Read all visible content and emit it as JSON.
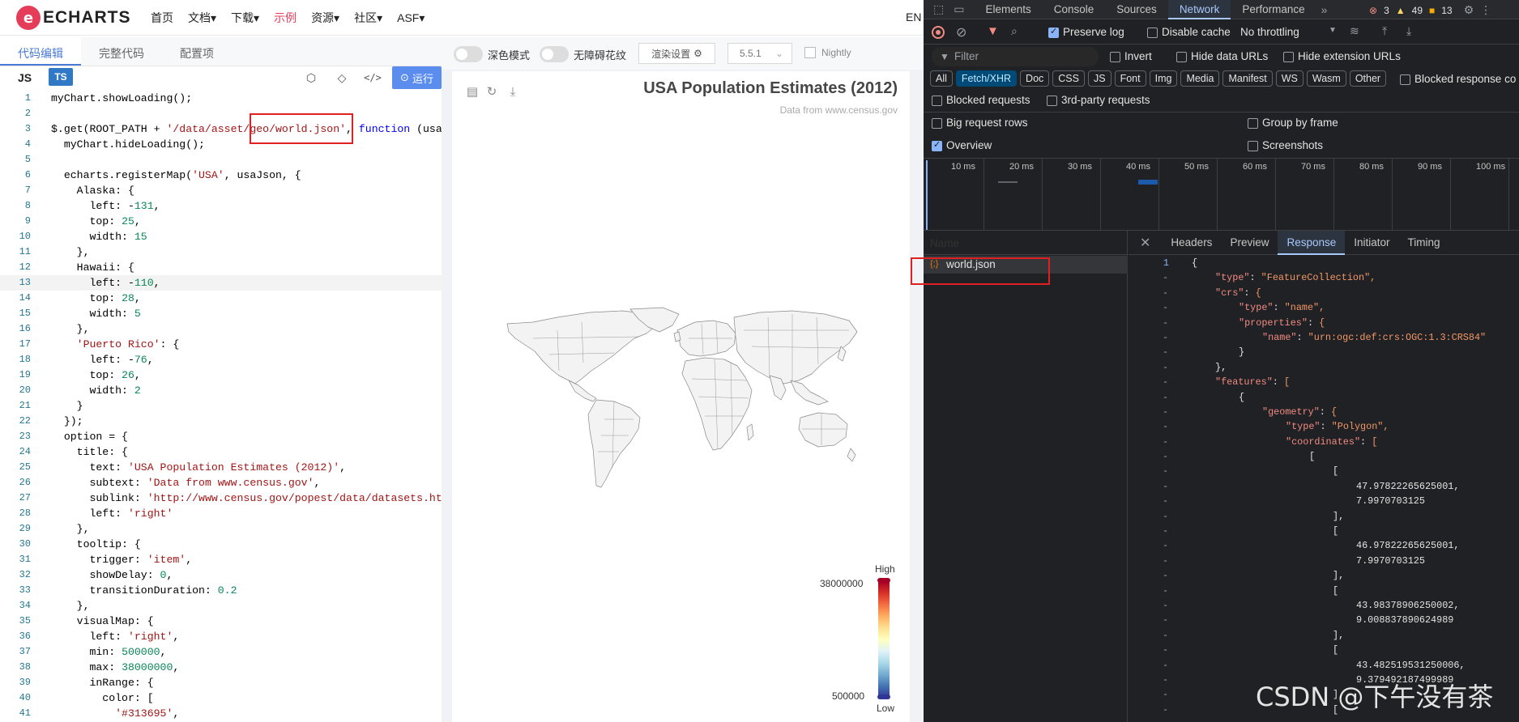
{
  "nav": {
    "logo_text": "ECHARTS",
    "links": [
      "首页",
      "文档▾",
      "下载▾",
      "示例",
      "资源▾",
      "社区▾",
      "ASF▾"
    ],
    "lang": "EN"
  },
  "editor": {
    "tabs": [
      "代码编辑",
      "完整代码",
      "配置项"
    ],
    "lang_js": "JS",
    "lang_ts": "TS",
    "run_label": "运行",
    "lines": [
      {
        "n": 1,
        "text": "myChart.showLoading();"
      },
      {
        "n": 2,
        "text": ""
      },
      {
        "n": 3,
        "text": "$.get(ROOT_PATH + '/data/asset/geo/world.json', function (usaJs"
      },
      {
        "n": 4,
        "text": "  myChart.hideLoading();"
      },
      {
        "n": 5,
        "text": ""
      },
      {
        "n": 6,
        "text": "  echarts.registerMap('USA', usaJson, {"
      },
      {
        "n": 7,
        "text": "    Alaska: {"
      },
      {
        "n": 8,
        "text": "      left: -131,"
      },
      {
        "n": 9,
        "text": "      top: 25,"
      },
      {
        "n": 10,
        "text": "      width: 15"
      },
      {
        "n": 11,
        "text": "    },"
      },
      {
        "n": 12,
        "text": "    Hawaii: {"
      },
      {
        "n": 13,
        "text": "      left: -110,"
      },
      {
        "n": 14,
        "text": "      top: 28,"
      },
      {
        "n": 15,
        "text": "      width: 5"
      },
      {
        "n": 16,
        "text": "    },"
      },
      {
        "n": 17,
        "text": "    'Puerto Rico': {"
      },
      {
        "n": 18,
        "text": "      left: -76,"
      },
      {
        "n": 19,
        "text": "      top: 26,"
      },
      {
        "n": 20,
        "text": "      width: 2"
      },
      {
        "n": 21,
        "text": "    }"
      },
      {
        "n": 22,
        "text": "  });"
      },
      {
        "n": 23,
        "text": "  option = {"
      },
      {
        "n": 24,
        "text": "    title: {"
      },
      {
        "n": 25,
        "text": "      text: 'USA Population Estimates (2012)',"
      },
      {
        "n": 26,
        "text": "      subtext: 'Data from www.census.gov',"
      },
      {
        "n": 27,
        "text": "      sublink: 'http://www.census.gov/popest/data/datasets.html"
      },
      {
        "n": 28,
        "text": "      left: 'right'"
      },
      {
        "n": 29,
        "text": "    },"
      },
      {
        "n": 30,
        "text": "    tooltip: {"
      },
      {
        "n": 31,
        "text": "      trigger: 'item',"
      },
      {
        "n": 32,
        "text": "      showDelay: 0,"
      },
      {
        "n": 33,
        "text": "      transitionDuration: 0.2"
      },
      {
        "n": 34,
        "text": "    },"
      },
      {
        "n": 35,
        "text": "    visualMap: {"
      },
      {
        "n": 36,
        "text": "      left: 'right',"
      },
      {
        "n": 37,
        "text": "      min: 500000,"
      },
      {
        "n": 38,
        "text": "      max: 38000000,"
      },
      {
        "n": 39,
        "text": "      inRange: {"
      },
      {
        "n": 40,
        "text": "        color: ["
      },
      {
        "n": 41,
        "text": "          '#313695',"
      }
    ]
  },
  "chart_toolbar": {
    "dark_mode": "深色模式",
    "a11y": "无障碍花纹",
    "render_settings": "渲染设置",
    "version": "5.5.1",
    "nightly": "Nightly"
  },
  "chart": {
    "title": "USA Population Estimates (2012)",
    "subtitle": "Data from www.census.gov",
    "visual_map": {
      "high_label": "High",
      "low_label": "Low",
      "max_text": "38000000",
      "min_text": "500000"
    }
  },
  "devtools": {
    "tabs": [
      "Elements",
      "Console",
      "Sources",
      "Network",
      "Performance"
    ],
    "active_tab": "Network",
    "counts": {
      "errors": "3",
      "warnings": "49",
      "info": "13"
    },
    "toolbar": {
      "preserve_log": "Preserve log",
      "disable_cache": "Disable cache",
      "throttling": "No throttling"
    },
    "filter": {
      "placeholder": "Filter",
      "invert": "Invert",
      "hide_data_urls": "Hide data URLs",
      "hide_extension_urls": "Hide extension URLs"
    },
    "types": [
      "All",
      "Fetch/XHR",
      "Doc",
      "CSS",
      "JS",
      "Font",
      "Img",
      "Media",
      "Manifest",
      "WS",
      "Wasm",
      "Other"
    ],
    "blocked_response": "Blocked response co",
    "blocked_requests": "Blocked requests",
    "third_party": "3rd-party requests",
    "big_rows": "Big request rows",
    "group_by_frame": "Group by frame",
    "overview": "Overview",
    "screenshots": "Screenshots",
    "timeline_ticks": [
      "10 ms",
      "20 ms",
      "30 ms",
      "40 ms",
      "50 ms",
      "60 ms",
      "70 ms",
      "80 ms",
      "90 ms",
      "100 ms"
    ],
    "name_header": "Name",
    "request_name": "world.json",
    "detail_tabs": [
      "Headers",
      "Preview",
      "Response",
      "Initiator",
      "Timing"
    ],
    "active_detail": "Response"
  },
  "response": [
    {
      "ln": "1",
      "indent": 0,
      "text": "{"
    },
    {
      "ln": "-",
      "indent": 1,
      "key": "\"type\"",
      "val": "\"FeatureCollection\","
    },
    {
      "ln": "-",
      "indent": 1,
      "key": "\"crs\"",
      "val": "{"
    },
    {
      "ln": "-",
      "indent": 2,
      "key": "\"type\"",
      "val": "\"name\","
    },
    {
      "ln": "-",
      "indent": 2,
      "key": "\"properties\"",
      "val": "{"
    },
    {
      "ln": "-",
      "indent": 3,
      "key": "\"name\"",
      "val": "\"urn:ogc:def:crs:OGC:1.3:CRS84\""
    },
    {
      "ln": "-",
      "indent": 2,
      "text": "}"
    },
    {
      "ln": "-",
      "indent": 1,
      "text": "},"
    },
    {
      "ln": "-",
      "indent": 1,
      "key": "\"features\"",
      "val": "["
    },
    {
      "ln": "-",
      "indent": 2,
      "text": "{"
    },
    {
      "ln": "-",
      "indent": 3,
      "key": "\"geometry\"",
      "val": "{"
    },
    {
      "ln": "-",
      "indent": 4,
      "key": "\"type\"",
      "val": "\"Polygon\","
    },
    {
      "ln": "-",
      "indent": 4,
      "key": "\"coordinates\"",
      "val": "["
    },
    {
      "ln": "-",
      "indent": 5,
      "text": "["
    },
    {
      "ln": "-",
      "indent": 6,
      "text": "["
    },
    {
      "ln": "-",
      "indent": 7,
      "text": "47.97822265625001,"
    },
    {
      "ln": "-",
      "indent": 7,
      "text": "7.9970703125"
    },
    {
      "ln": "-",
      "indent": 6,
      "text": "],"
    },
    {
      "ln": "-",
      "indent": 6,
      "text": "["
    },
    {
      "ln": "-",
      "indent": 7,
      "text": "46.97822265625001,"
    },
    {
      "ln": "-",
      "indent": 7,
      "text": "7.9970703125"
    },
    {
      "ln": "-",
      "indent": 6,
      "text": "],"
    },
    {
      "ln": "-",
      "indent": 6,
      "text": "["
    },
    {
      "ln": "-",
      "indent": 7,
      "text": "43.98378906250002,"
    },
    {
      "ln": "-",
      "indent": 7,
      "text": "9.008837890624989"
    },
    {
      "ln": "-",
      "indent": 6,
      "text": "],"
    },
    {
      "ln": "-",
      "indent": 6,
      "text": "["
    },
    {
      "ln": "-",
      "indent": 7,
      "text": "43.482519531250006,"
    },
    {
      "ln": "-",
      "indent": 7,
      "text": "9.379492187499989"
    },
    {
      "ln": "-",
      "indent": 6,
      "text": "],"
    },
    {
      "ln": "-",
      "indent": 6,
      "text": "["
    }
  ],
  "watermark": "CSDN @下午没有茶",
  "colors": {
    "accent": "#e43c59",
    "link": "#4a7ad6",
    "devtools_bg": "#202124",
    "devtools_active": "#a8c7fa"
  }
}
